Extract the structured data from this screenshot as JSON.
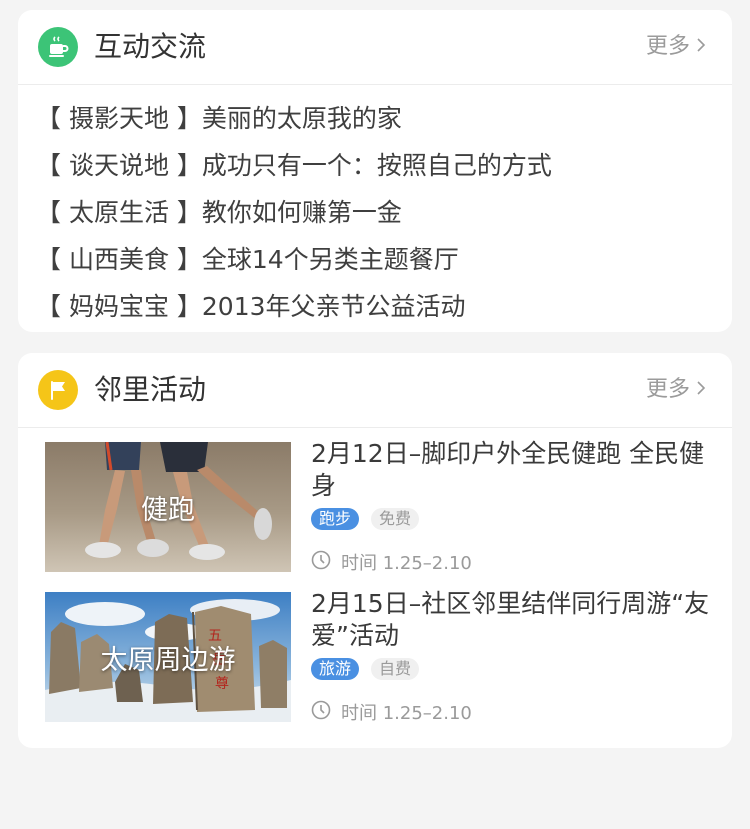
{
  "interaction": {
    "title": "互动交流",
    "more": "更多",
    "icon": "coffee-cup-icon",
    "icon_color": "#3cc477",
    "topics": [
      "【 摄影天地 】美丽的太原我的家",
      "【 谈天说地 】成功只有一个：按照自己的方式",
      "【 太原生活 】教你如何赚第一金",
      "【 山西美食 】全球14个另类主题餐厅",
      "【 妈妈宝宝 】2013年父亲节公益活动"
    ]
  },
  "activities": {
    "title": "邻里活动",
    "more": "更多",
    "icon": "flag-icon",
    "icon_color": "#f5c518",
    "items": [
      {
        "thumb_label": "健跑",
        "title": "2月12日–脚印户外全民健跑  全民健身",
        "tag_primary": "跑步",
        "tag_secondary": "免费",
        "time": "时间 1.25–2.10"
      },
      {
        "thumb_label": "太原周边游",
        "title": "2月15日–社区邻里结伴同行周游“友爱”活动",
        "tag_primary": "旅游",
        "tag_secondary": "自费",
        "time": "时间 1.25–2.10"
      }
    ]
  }
}
